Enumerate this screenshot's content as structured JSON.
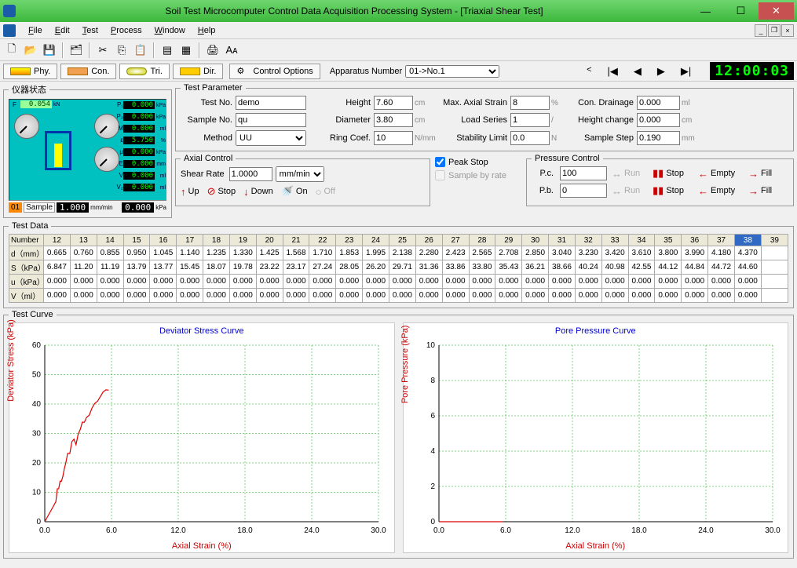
{
  "window": {
    "title": "Soil Test Microcomputer Control Data Acquisition Processing System - [Triaxial Shear Test]"
  },
  "menu": {
    "items": [
      "File",
      "Edit",
      "Test",
      "Process",
      "Window",
      "Help"
    ]
  },
  "tabs": {
    "phy": "Phy.",
    "con": "Con.",
    "tri": "Tri.",
    "dir": "Dir.",
    "ctrlopt": "Control Options",
    "appnum_label": "Apparatus Number",
    "appnum_value": "01->No.1"
  },
  "clock": "12:00:03",
  "instrument": {
    "grouplabel": "仪器状态",
    "F_label": "F",
    "F_val": "0.054",
    "F_unit": "kN",
    "readouts": [
      {
        "lbl": "P₁",
        "val": "0.000",
        "unit": "kPa"
      },
      {
        "lbl": "P₂",
        "val": "0.000",
        "unit": "kPa"
      },
      {
        "lbl": "M",
        "val": "0.000",
        "unit": "ml"
      },
      {
        "lbl": "ε",
        "val": "5.750",
        "unit": "%"
      },
      {
        "lbl": "μ",
        "val": "0.000",
        "unit": "kPa"
      },
      {
        "lbl": "E",
        "val": "0.000",
        "unit": "mm"
      },
      {
        "lbl": "V",
        "val": "0.000",
        "unit": "ml"
      },
      {
        "lbl": "V₂",
        "val": "0.000",
        "unit": "ml"
      }
    ],
    "sample_no": "01",
    "sample_lbl": "Sample",
    "rate": "1.000",
    "rate_unit": "mm/min",
    "p3": "0.000",
    "p3_unit": "kPa"
  },
  "params": {
    "legend": "Test Parameter",
    "testno_l": "Test No.",
    "testno": "demo",
    "height_l": "Height",
    "height": "7.60",
    "height_u": "cm",
    "maxstrain_l": "Max. Axial Strain",
    "maxstrain": "8",
    "maxstrain_u": "%",
    "drainage_l": "Con. Drainage",
    "drainage": "0.000",
    "drainage_u": "ml",
    "sampleno_l": "Sample No.",
    "sampleno": "qu",
    "diameter_l": "Diameter",
    "diameter": "3.80",
    "diameter_u": "cm",
    "loadseries_l": "Load Series",
    "loadseries": "1",
    "loadseries_u": "/",
    "hchange_l": "Height change",
    "hchange": "0.000",
    "hchange_u": "cm",
    "method_l": "Method",
    "method": "UU",
    "ringcoef_l": "Ring Coef.",
    "ringcoef": "10",
    "ringcoef_u": "N/mm",
    "stablim_l": "Stability Limit",
    "stablim": "0.0",
    "stablim_u": "N",
    "step_l": "Sample Step",
    "step": "0.190",
    "step_u": "mm"
  },
  "axial": {
    "legend": "Axial Control",
    "shearrate_l": "Shear Rate",
    "shearrate": "1.0000",
    "shearrate_u": "mm/min",
    "up": "Up",
    "stop": "Stop",
    "down": "Down",
    "on": "On",
    "off": "Off"
  },
  "peak": {
    "peakstop": "Peak Stop",
    "samplebyrate": "Sample by rate"
  },
  "pressure": {
    "legend": "Pressure Control",
    "pc_l": "P.c.",
    "pc": "100",
    "pb_l": "P.b.",
    "pb": "0",
    "run": "Run",
    "stop": "Stop",
    "empty": "Empty",
    "fill": "Fill"
  },
  "testdata": {
    "legend": "Test Data",
    "rowheads": [
      "Number",
      "d（mm）",
      "S（kPa）",
      "u（kPa）",
      "V（ml）"
    ],
    "cols": [
      "12",
      "13",
      "14",
      "15",
      "16",
      "17",
      "18",
      "19",
      "20",
      "21",
      "22",
      "23",
      "24",
      "25",
      "26",
      "27",
      "28",
      "29",
      "30",
      "31",
      "32",
      "33",
      "34",
      "35",
      "36",
      "37",
      "38",
      "39"
    ],
    "selected_col": "38",
    "rows": [
      [
        "0.665",
        "0.760",
        "0.855",
        "0.950",
        "1.045",
        "1.140",
        "1.235",
        "1.330",
        "1.425",
        "1.568",
        "1.710",
        "1.853",
        "1.995",
        "2.138",
        "2.280",
        "2.423",
        "2.565",
        "2.708",
        "2.850",
        "3.040",
        "3.230",
        "3.420",
        "3.610",
        "3.800",
        "3.990",
        "4.180",
        "4.370",
        ""
      ],
      [
        "6.847",
        "11.20",
        "11.19",
        "13.79",
        "13.77",
        "15.45",
        "18.07",
        "19.78",
        "23.22",
        "23.17",
        "27.24",
        "28.05",
        "26.20",
        "29.71",
        "31.36",
        "33.86",
        "33.80",
        "35.43",
        "36.21",
        "38.66",
        "40.24",
        "40.98",
        "42.55",
        "44.12",
        "44.84",
        "44.72",
        "44.60",
        ""
      ],
      [
        "0.000",
        "0.000",
        "0.000",
        "0.000",
        "0.000",
        "0.000",
        "0.000",
        "0.000",
        "0.000",
        "0.000",
        "0.000",
        "0.000",
        "0.000",
        "0.000",
        "0.000",
        "0.000",
        "0.000",
        "0.000",
        "0.000",
        "0.000",
        "0.000",
        "0.000",
        "0.000",
        "0.000",
        "0.000",
        "0.000",
        "0.000",
        ""
      ],
      [
        "0.000",
        "0.000",
        "0.000",
        "0.000",
        "0.000",
        "0.000",
        "0.000",
        "0.000",
        "0.000",
        "0.000",
        "0.000",
        "0.000",
        "0.000",
        "0.000",
        "0.000",
        "0.000",
        "0.000",
        "0.000",
        "0.000",
        "0.000",
        "0.000",
        "0.000",
        "0.000",
        "0.000",
        "0.000",
        "0.000",
        "0.000",
        ""
      ]
    ]
  },
  "curves": {
    "legend": "Test Curve",
    "left_title": "Deviator Stress Curve",
    "right_title": "Pore Pressure Curve",
    "xlabel": "Axial Strain (%)",
    "left_ylabel": "Deviator Stress (kPa)",
    "right_ylabel": "Pore Pressure (kPa)"
  },
  "chart_data": [
    {
      "type": "line",
      "title": "Deviator Stress Curve",
      "xlabel": "Axial Strain (%)",
      "ylabel": "Deviator Stress (kPa)",
      "xlim": [
        0,
        30
      ],
      "ylim": [
        0,
        60
      ],
      "xticks": [
        0,
        6,
        12,
        18,
        24,
        30
      ],
      "yticks": [
        0,
        10,
        20,
        30,
        40,
        50,
        60
      ],
      "series": [
        {
          "name": "Deviator Stress",
          "x": [
            0.0,
            0.25,
            0.5,
            0.75,
            1.0,
            1.13,
            1.25,
            1.38,
            1.5,
            1.63,
            1.76,
            1.88,
            2.06,
            2.25,
            2.44,
            2.63,
            2.81,
            3.0,
            3.19,
            3.38,
            3.56,
            3.75,
            4.0,
            4.25,
            4.5,
            4.75,
            5.0,
            5.25,
            5.5,
            5.75
          ],
          "y": [
            0.0,
            1.7,
            3.4,
            5.1,
            6.85,
            11.2,
            11.19,
            13.79,
            13.77,
            15.45,
            18.07,
            19.78,
            23.22,
            23.17,
            27.24,
            28.05,
            26.2,
            29.71,
            31.36,
            33.86,
            33.8,
            35.43,
            36.21,
            38.66,
            40.24,
            40.98,
            42.55,
            44.12,
            44.84,
            44.72
          ]
        }
      ]
    },
    {
      "type": "line",
      "title": "Pore Pressure Curve",
      "xlabel": "Axial Strain (%)",
      "ylabel": "Pore Pressure (kPa)",
      "xlim": [
        0,
        30
      ],
      "ylim": [
        0,
        10
      ],
      "xticks": [
        0,
        6,
        12,
        18,
        24,
        30
      ],
      "yticks": [
        0,
        2,
        4,
        6,
        8,
        10
      ],
      "series": [
        {
          "name": "Pore Pressure",
          "x": [
            0.0,
            5.75
          ],
          "y": [
            0.0,
            0.0
          ]
        }
      ]
    }
  ]
}
